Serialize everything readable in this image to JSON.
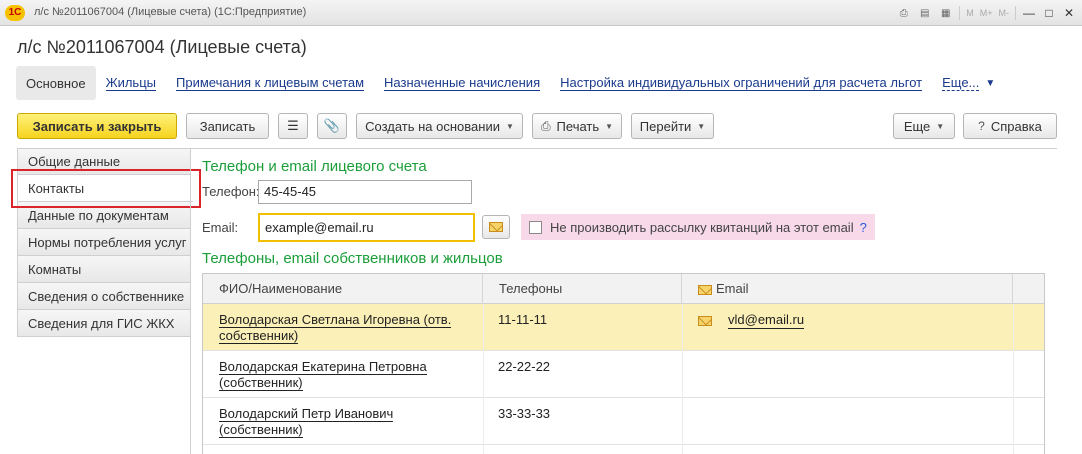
{
  "window": {
    "logo": "1C",
    "title": "л/с №2011067004 (Лицевые счета)  (1С:Предприятие)",
    "tool_icons": [
      "printer-icon",
      "document-icon",
      "calendar-icon"
    ],
    "m_labels": [
      "M",
      "M+",
      "M-"
    ]
  },
  "doc": {
    "title": "л/с №2011067004 (Лицевые счета)"
  },
  "tabs": [
    {
      "label": "Основное",
      "active": true
    },
    {
      "label": "Жильцы"
    },
    {
      "label": "Примечания к лицевым счетам"
    },
    {
      "label": "Назначенные начисления"
    },
    {
      "label": "Настройка индивидуальных ограничений для расчета льгот"
    },
    {
      "label": "Еще..."
    }
  ],
  "toolbar": {
    "save_close": "Записать и закрыть",
    "save": "Записать",
    "create_based": "Создать на основании",
    "print": "Печать",
    "goto": "Перейти",
    "more": "Еще",
    "help_q": "?",
    "help": "Справка"
  },
  "sidebar": {
    "items": [
      "Общие данные",
      "Контакты",
      "Данные по документам",
      "Нормы потребления услуг",
      "Комнаты",
      "Сведения о собственнике",
      "Сведения для ГИС ЖКХ"
    ],
    "active_index": 1
  },
  "contacts": {
    "section1_title": "Телефон и email лицевого счета",
    "phone_label": "Телефон:",
    "phone_value": "45-45-45",
    "email_label": "Email:",
    "email_value": "example@email.ru",
    "no_mail_label": "Не производить рассылку квитанций на этот email",
    "help_q": "?",
    "section2_title": "Телефоны, email собственников и жильцов"
  },
  "grid": {
    "columns": {
      "name": "ФИО/Наименование",
      "phones": "Телефоны",
      "email": "Email"
    },
    "rows": [
      {
        "name_line1": "Володарская Светлана Игоревна (отв.",
        "name_line2": "собственник)",
        "phone": "11-11-11",
        "email": "vld@email.ru",
        "selected": true
      },
      {
        "name_line1": "Володарская Екатерина Петровна",
        "name_line2": "(собственник)",
        "phone": "22-22-22",
        "email": "",
        "selected": false
      },
      {
        "name_line1": "Володарский Петр Иванович",
        "name_line2": "(собственник)",
        "phone": "33-33-33",
        "email": "",
        "selected": false
      }
    ]
  },
  "colors": {
    "accent_green": "#1b9e3a",
    "primary_yellow": "#f6d31f",
    "highlight_red": "#d9242a",
    "link_blue": "#1a3a8c"
  }
}
